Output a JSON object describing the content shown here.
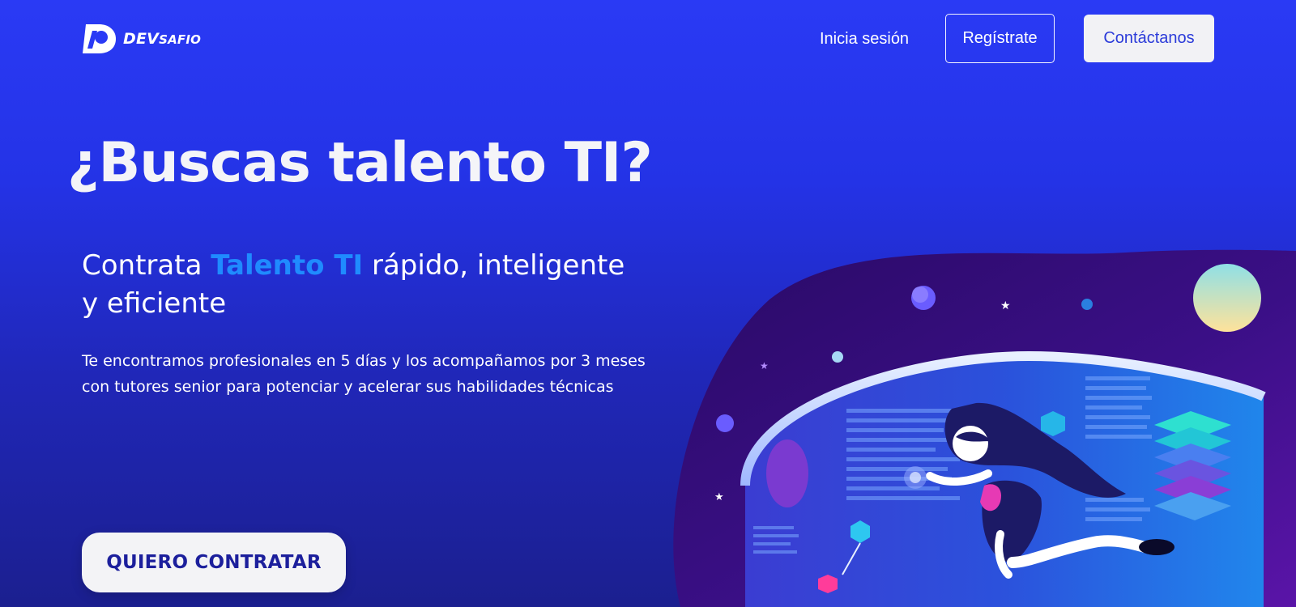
{
  "header": {
    "logo_main": "DEV",
    "logo_small": "SAFIO",
    "login_label": "Inicia sesión",
    "register_label": "Regístrate",
    "contact_label": "Contáctanos"
  },
  "hero": {
    "title": "¿Buscas talento TI?",
    "subtitle_part1": "Contrata ",
    "subtitle_accent": "Talento TI",
    "subtitle_part2": " rápido, inteligente y eficiente",
    "description": "Te encontramos profesionales en 5 días y los acompañamos por 3 meses con tutores senior para potenciar y acelerar sus habilidades técnicas",
    "cta_label": "QUIERO CONTRATAR"
  },
  "colors": {
    "background_top": "#2a3af5",
    "background_bottom": "#1b1f8f",
    "accent": "#1f8bff",
    "cta_text": "#1c1f9c",
    "contact_text": "#2b3bd9"
  },
  "icons": {
    "logo": "devsafio-logo-icon",
    "illustration": "hero-illustration"
  }
}
